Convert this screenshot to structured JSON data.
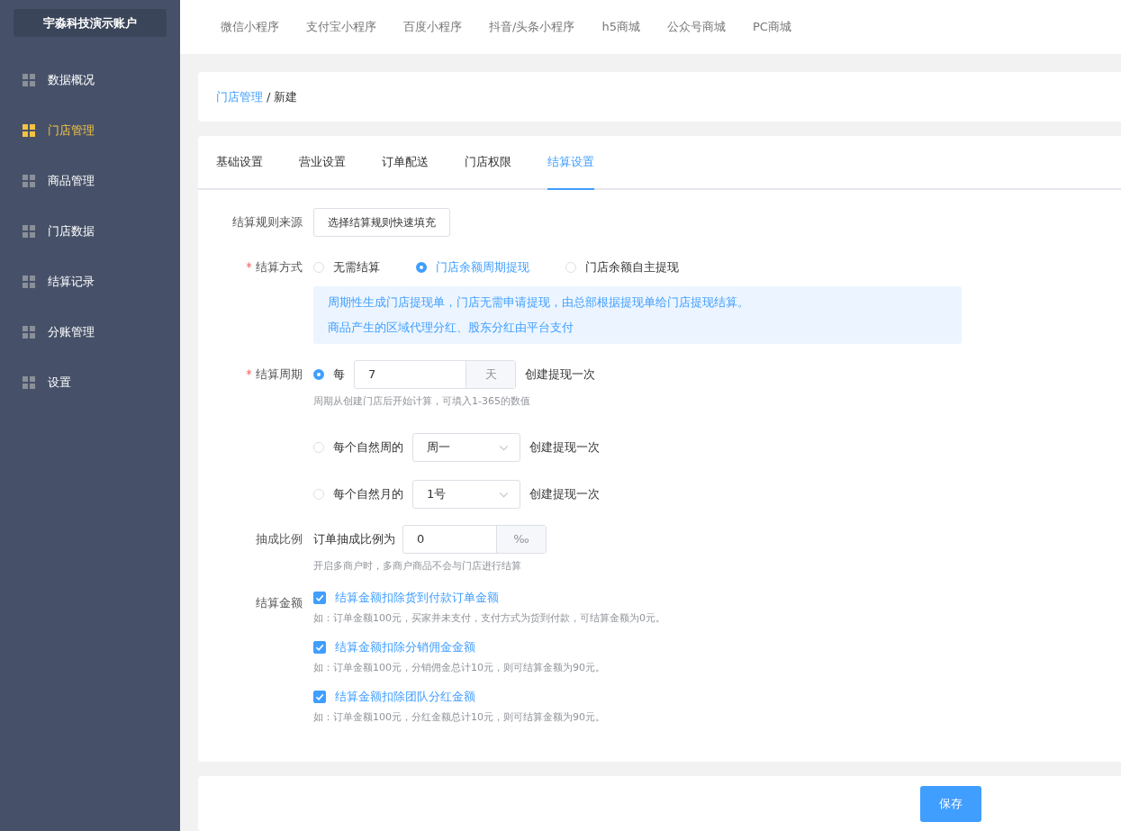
{
  "sidebar": {
    "account": "宇淼科技演示账户",
    "items": [
      {
        "label": "数据概况",
        "selected": false
      },
      {
        "label": "门店管理",
        "selected": true
      },
      {
        "label": "商品管理",
        "selected": false
      },
      {
        "label": "门店数据",
        "selected": false
      },
      {
        "label": "结算记录",
        "selected": false
      },
      {
        "label": "分账管理",
        "selected": false
      },
      {
        "label": "设置",
        "selected": false
      }
    ]
  },
  "top_nav": [
    "微信小程序",
    "支付宝小程序",
    "百度小程序",
    "抖音/头条小程序",
    "h5商城",
    "公众号商城",
    "PC商城"
  ],
  "breadcrumb": {
    "parent": "门店管理",
    "separator": "/",
    "current": "新建"
  },
  "tabs": [
    {
      "label": "基础设置",
      "selected": false
    },
    {
      "label": "营业设置",
      "selected": false
    },
    {
      "label": "订单配送",
      "selected": false
    },
    {
      "label": "门店权限",
      "selected": false
    },
    {
      "label": "结算设置",
      "selected": true
    }
  ],
  "form": {
    "rule_source": {
      "label": "结算规则来源",
      "button": "选择结算规则快速填充"
    },
    "method": {
      "label": "结算方式",
      "required": true,
      "options": [
        {
          "label": "无需结算",
          "selected": false
        },
        {
          "label": "门店余额周期提现",
          "selected": true
        },
        {
          "label": "门店余额自主提现",
          "selected": false
        }
      ],
      "info": [
        "周期性生成门店提现单，门店无需申请提现，由总部根据提现单给门店提现结算。",
        "商品产生的区域代理分红、股东分红由平台支付"
      ]
    },
    "period": {
      "label": "结算周期",
      "required": true,
      "options": [
        {
          "kind": "input",
          "selected": true,
          "prefix": "每",
          "value": "7",
          "unit": "天",
          "suffix": "创建提现一次",
          "hint": "周期从创建门店后开始计算，可填入1-365的数值"
        },
        {
          "kind": "select",
          "selected": false,
          "prefix": "每个自然周的",
          "value": "周一",
          "suffix": "创建提现一次"
        },
        {
          "kind": "select",
          "selected": false,
          "prefix": "每个自然月的",
          "value": "1号",
          "suffix": "创建提现一次"
        }
      ]
    },
    "ratio": {
      "label": "抽成比例",
      "prefix": "订单抽成比例为",
      "value": "0",
      "unit": "‰",
      "hint": "开启多商户时，多商户商品不会与门店进行结算"
    },
    "amount": {
      "label": "结算金额",
      "options": [
        {
          "label": "结算金额扣除货到付款订单金额",
          "checked": true,
          "hint": "如：订单金额100元，买家并未支付，支付方式为货到付款，可结算金额为0元。"
        },
        {
          "label": "结算金额扣除分销佣金金额",
          "checked": true,
          "hint": "如：订单金额100元，分销佣金总计10元，则可结算金额为90元。"
        },
        {
          "label": "结算金额扣除团队分红金额",
          "checked": true,
          "hint": "如：订单金额100元，分红金额总计10元，则可结算金额为90元。"
        }
      ]
    }
  },
  "save_button": "保存"
}
